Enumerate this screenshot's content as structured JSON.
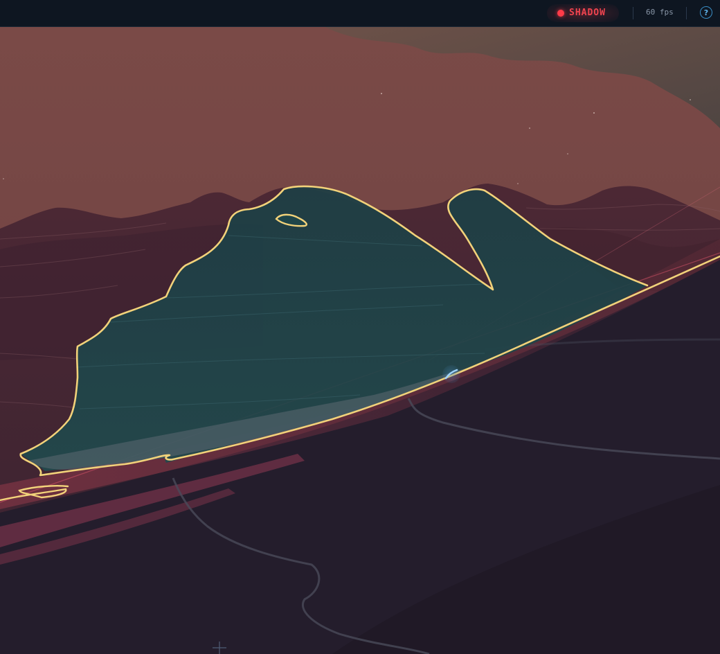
{
  "toolbar": {
    "mode_label": "SHADOW",
    "fps_label": "60 fps",
    "help_glyph": "?"
  },
  "icons": {
    "mode_indicator": "red-dot-icon",
    "help": "help-icon",
    "crosshair": "crosshair-icon",
    "marker": "location-marker-icon"
  },
  "colors": {
    "sky": "#744744",
    "haze": "#5a4842",
    "terrain_dark": "#221c2a",
    "selection_fill": "#1f4549",
    "selection_outline": "#f2d27a",
    "mode_accent": "#ff3b48",
    "topbar": "#0e1621"
  }
}
